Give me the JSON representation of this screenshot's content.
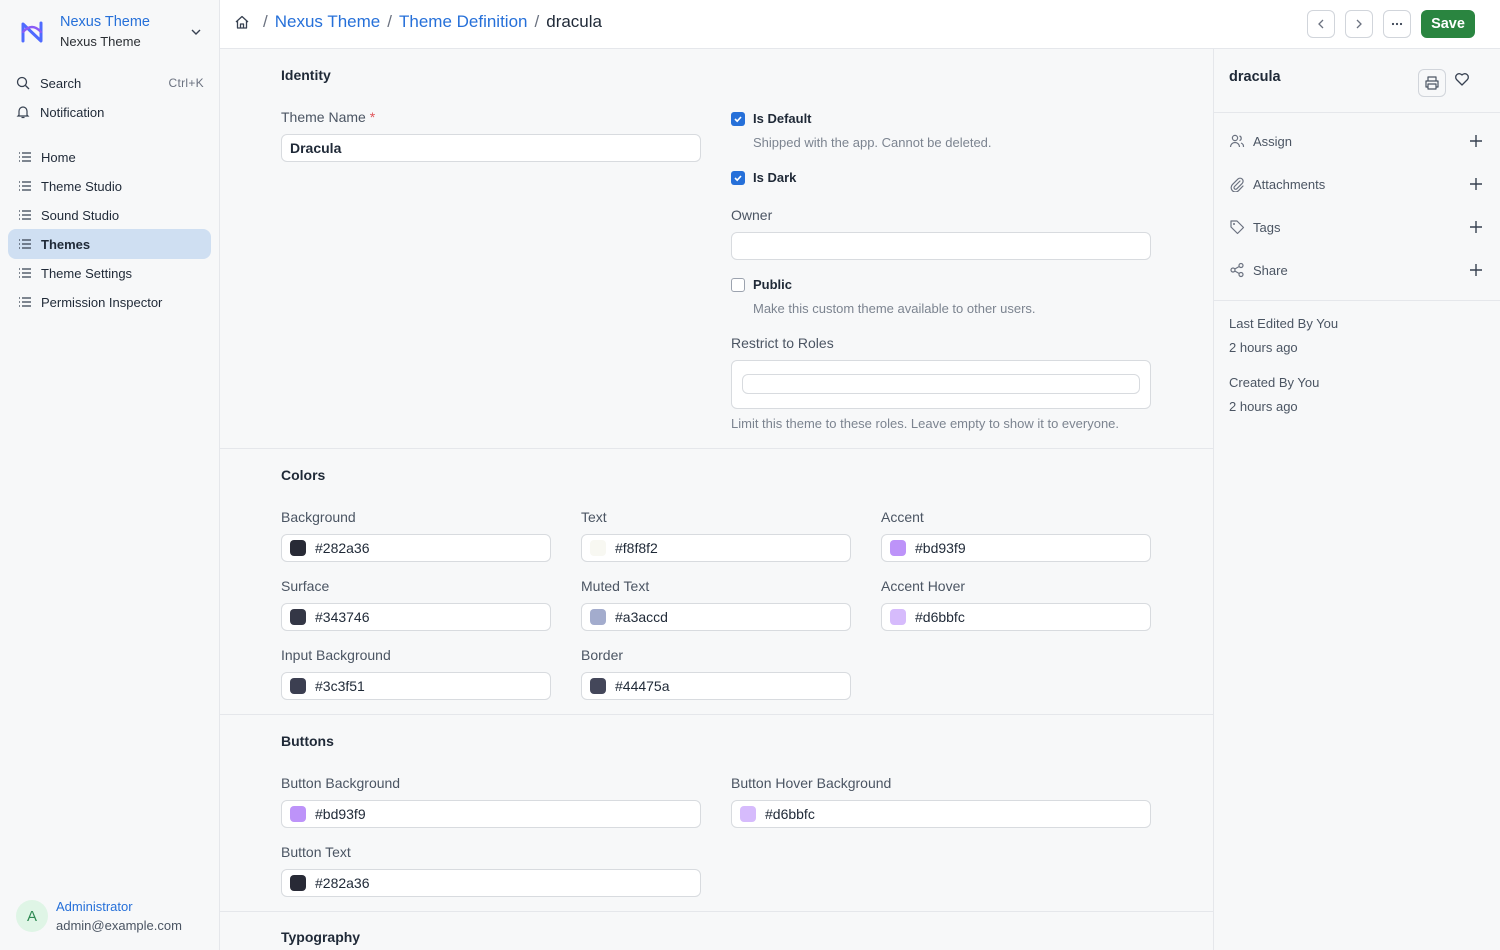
{
  "app": {
    "brand_title": "Nexus Theme",
    "brand_subtitle": "Nexus Theme",
    "accent_color": "#2670d9",
    "save_color": "#2a8540"
  },
  "sidebar": {
    "search_label": "Search",
    "search_shortcut": "Ctrl+K",
    "notification_label": "Notification",
    "items": [
      {
        "label": "Home",
        "active": false
      },
      {
        "label": "Theme Studio",
        "active": false
      },
      {
        "label": "Sound Studio",
        "active": false
      },
      {
        "label": "Themes",
        "active": true
      },
      {
        "label": "Theme Settings",
        "active": false
      },
      {
        "label": "Permission Inspector",
        "active": false
      }
    ],
    "user": {
      "initial": "A",
      "name": "Administrator",
      "email": "admin@example.com"
    }
  },
  "topbar": {
    "breadcrumbs": [
      "Nexus Theme",
      "Theme Definition"
    ],
    "current": "dracula",
    "save_label": "Save"
  },
  "form": {
    "identity": {
      "title": "Identity",
      "theme_name_label": "Theme Name",
      "theme_name_required": "*",
      "theme_name_value": "Dracula",
      "is_default_label": "Is Default",
      "is_default_checked": true,
      "is_default_hint": "Shipped with the app. Cannot be deleted.",
      "is_dark_label": "Is Dark",
      "is_dark_checked": true,
      "owner_label": "Owner",
      "owner_value": "",
      "public_label": "Public",
      "public_checked": false,
      "public_hint": "Make this custom theme available to other users.",
      "roles_label": "Restrict to Roles",
      "roles_hint": "Limit this theme to these roles. Leave empty to show it to everyone."
    },
    "colors": {
      "title": "Colors",
      "fields": [
        {
          "label": "Background",
          "value": "#282a36"
        },
        {
          "label": "Text",
          "value": "#f8f8f2"
        },
        {
          "label": "Accent",
          "value": "#bd93f9"
        },
        {
          "label": "Surface",
          "value": "#343746"
        },
        {
          "label": "Muted Text",
          "value": "#a3accd"
        },
        {
          "label": "Accent Hover",
          "value": "#d6bbfc"
        },
        {
          "label": "Input Background",
          "value": "#3c3f51"
        },
        {
          "label": "Border",
          "value": "#44475a"
        }
      ]
    },
    "buttons": {
      "title": "Buttons",
      "fields": [
        {
          "label": "Button Background",
          "value": "#bd93f9"
        },
        {
          "label": "Button Hover Background",
          "value": "#d6bbfc"
        },
        {
          "label": "Button Text",
          "value": "#282a36"
        }
      ]
    },
    "typography": {
      "title": "Typography"
    }
  },
  "rightpanel": {
    "title": "dracula",
    "actions": [
      "Assign",
      "Attachments",
      "Tags",
      "Share"
    ],
    "last_edited": "Last Edited By You",
    "last_edited_time": "2 hours ago",
    "created": "Created By You",
    "created_time": "2 hours ago"
  }
}
